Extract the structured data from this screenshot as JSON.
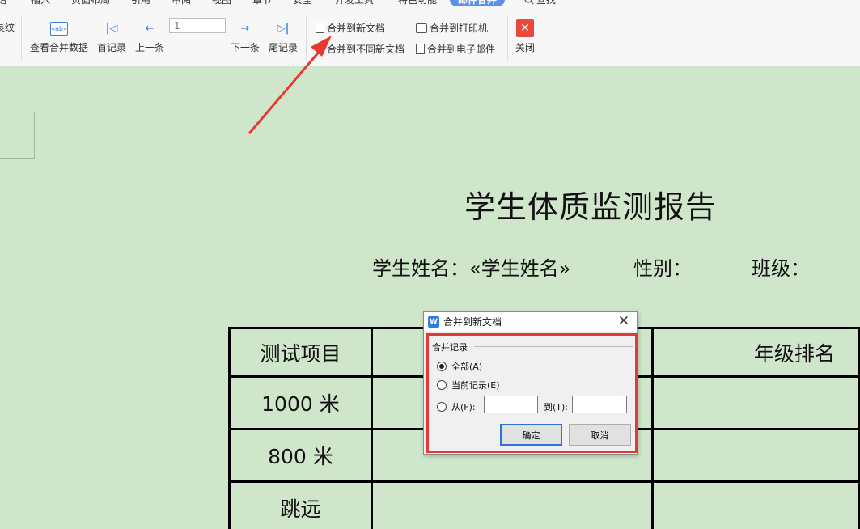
{
  "ribbon": {
    "menu": [
      "始",
      "插入",
      "页面布局",
      "引用",
      "审阅",
      "视图",
      "章节",
      "安全",
      "开发工具",
      "特色功能",
      "邮件合并",
      "查找"
    ],
    "active_menu": "邮件合并",
    "left_partial_label": "長纹",
    "view_merged_data": "查看合并数据",
    "first_record": "首记录",
    "prev_record": "上一条",
    "record_input_value": "1",
    "next_record": "下一条",
    "last_record": "尾记录",
    "merge_to_new_doc": "合并到新文档",
    "merge_to_different_docs": "合并到不同新文档",
    "merge_to_printer": "合并到打印机",
    "merge_to_email": "合并到电子邮件",
    "close": "关闭",
    "field_icon_text": "«ab»"
  },
  "document": {
    "title": "学生体质监测报告",
    "student_name_label": "学生姓名：«学生姓名»",
    "gender_label": "性别：",
    "class_label": "班级：",
    "table": {
      "header": [
        "测试项目",
        "",
        "年级排名"
      ],
      "rows": [
        [
          "1000 米",
          "",
          ""
        ],
        [
          "800 米",
          "",
          ""
        ],
        [
          "跳远",
          "",
          ""
        ]
      ]
    }
  },
  "dialog": {
    "title": "合并到新文档",
    "app_icon": "W",
    "group_label": "合并记录",
    "option_all": "全部(A)",
    "option_current": "当前记录(E)",
    "option_from": "从(F):",
    "to_label": "到(T):",
    "from_value": "",
    "to_value": "",
    "ok": "确定",
    "cancel": "取消",
    "selected_option": "全部(A)"
  },
  "colors": {
    "page_background": "#cfe6cb",
    "accent": "#5b8fe8",
    "highlight_border": "#e53935",
    "annotation_arrow": "#e53935",
    "close_button": "#e74a3b"
  }
}
